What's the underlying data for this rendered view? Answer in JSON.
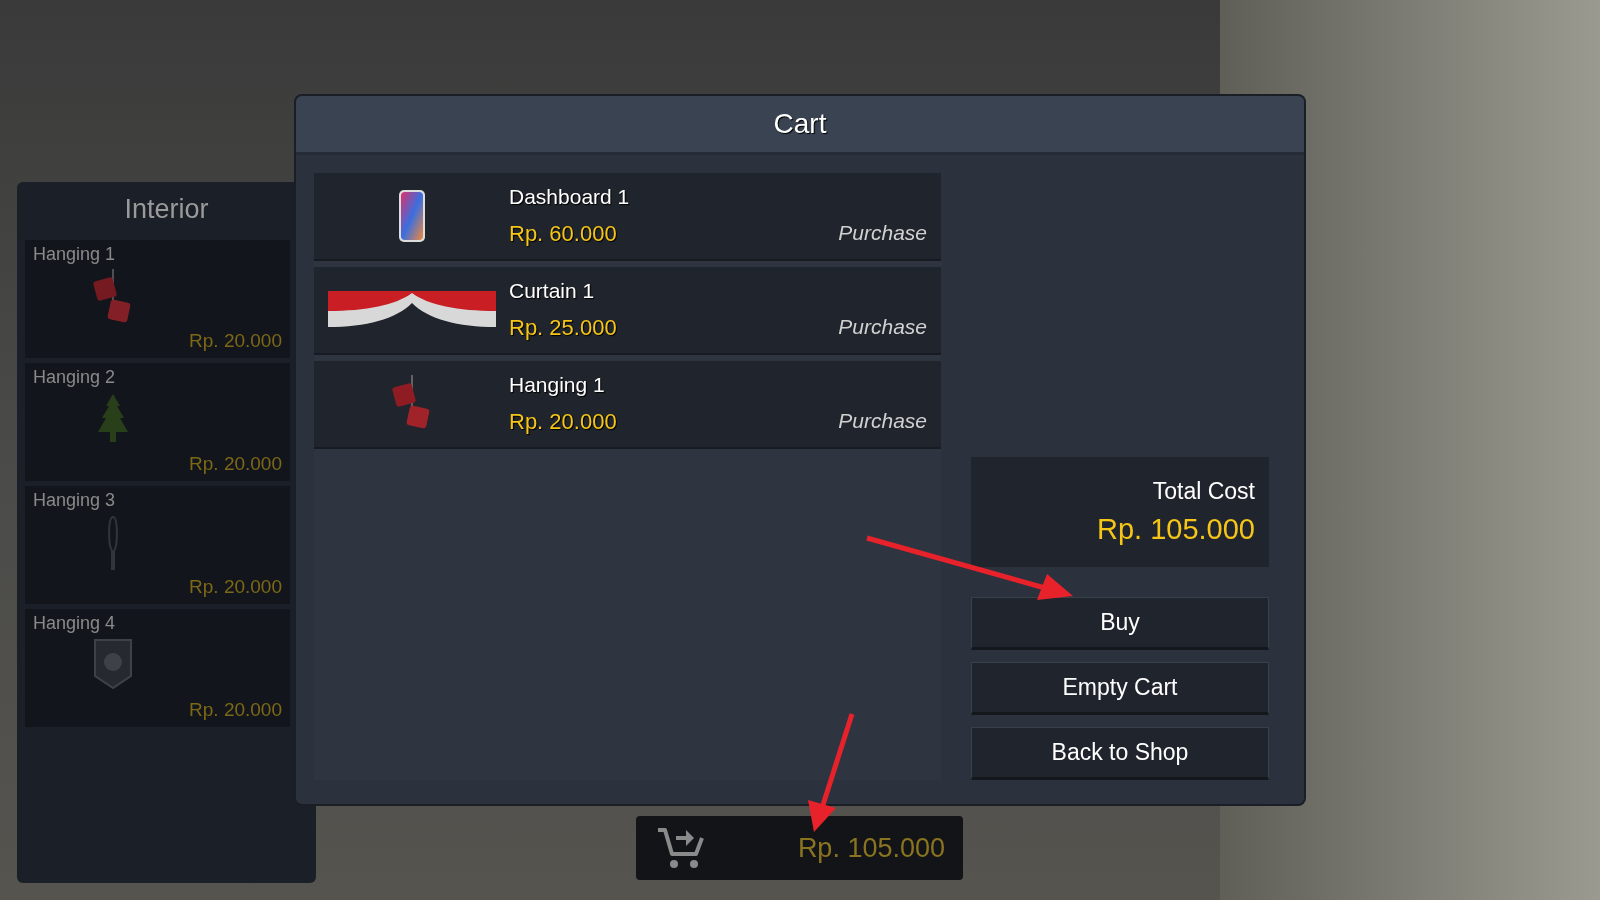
{
  "sidebar": {
    "title": "Interior",
    "items": [
      {
        "name": "Hanging 1",
        "price": "Rp. 20.000",
        "kind": "dice"
      },
      {
        "name": "Hanging 2",
        "price": "Rp. 20.000",
        "kind": "tree"
      },
      {
        "name": "Hanging 3",
        "price": "Rp. 20.000",
        "kind": "stick"
      },
      {
        "name": "Hanging 4",
        "price": "Rp. 20.000",
        "kind": "badge"
      }
    ]
  },
  "cart": {
    "title": "Cart",
    "items": [
      {
        "name": "Dashboard 1",
        "price": "Rp. 60.000",
        "action": "Purchase",
        "kind": "phone"
      },
      {
        "name": "Curtain 1",
        "price": "Rp. 25.000",
        "action": "Purchase",
        "kind": "curtain"
      },
      {
        "name": "Hanging 1",
        "price": "Rp. 20.000",
        "action": "Purchase",
        "kind": "dice"
      }
    ],
    "total_label": "Total Cost",
    "total": "Rp. 105.000",
    "buttons": [
      "Buy",
      "Empty Cart",
      "Back to Shop"
    ]
  },
  "cart_bar": {
    "total": "Rp. 105.000"
  }
}
